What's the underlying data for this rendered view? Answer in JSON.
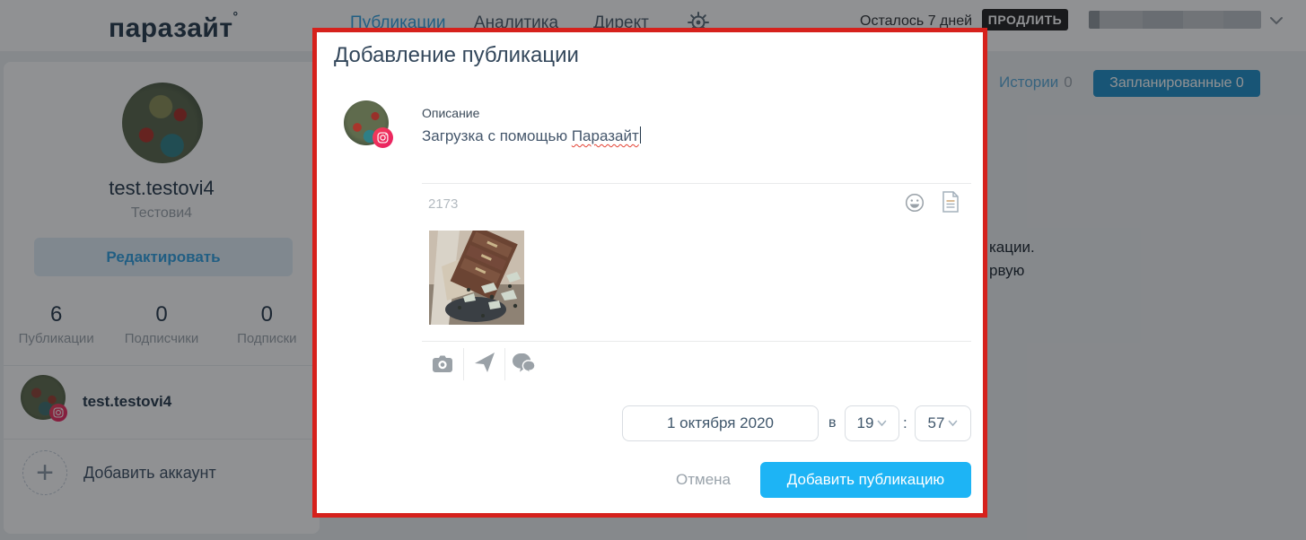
{
  "header": {
    "logo": "паразайт",
    "logo_mark": "°",
    "nav": [
      {
        "label": "Публикации",
        "active": true
      },
      {
        "label": "Аналитика",
        "active": false
      },
      {
        "label": "Директ",
        "active": false
      }
    ],
    "days_left": "Осталось 7 дней",
    "extend_button": "ПРОДЛИТЬ"
  },
  "sidebar": {
    "username": "test.testovi4",
    "display_name": "Тестови4",
    "edit_button": "Редактировать",
    "stats": [
      {
        "value": "6",
        "label": "Публикации"
      },
      {
        "value": "0",
        "label": "Подписчики"
      },
      {
        "value": "0",
        "label": "Подписки"
      }
    ],
    "account": {
      "username": "test.testovi4"
    },
    "add_account_label": "Добавить аккаунт",
    "add_plus": "+"
  },
  "content": {
    "stories_tab": "Истории",
    "stories_count": "0",
    "planned_tab": "Запланированные 0",
    "clipped_line1": "кации.",
    "clipped_line2": "рвую"
  },
  "modal": {
    "title": "Добавление публикации",
    "description_label": "Описание",
    "description_text": "Загрузка с помощью ",
    "description_misspelled_word": "Паразайт",
    "char_count": "2173",
    "date_value": "1 октября 2020",
    "time_preposition": "в",
    "hour": "19",
    "time_colon": ":",
    "minute": "57",
    "cancel_button": "Отмена",
    "submit_button": "Добавить публикацию"
  },
  "colors": {
    "accent_blue": "#1db4f5",
    "nav_active_blue": "#2e9fe0",
    "planned_button_blue": "#1e8fc9",
    "modal_highlight_border": "#d6211c",
    "instagram_badge": "#e91e63",
    "extend_button_bg": "#1f1f1f"
  }
}
